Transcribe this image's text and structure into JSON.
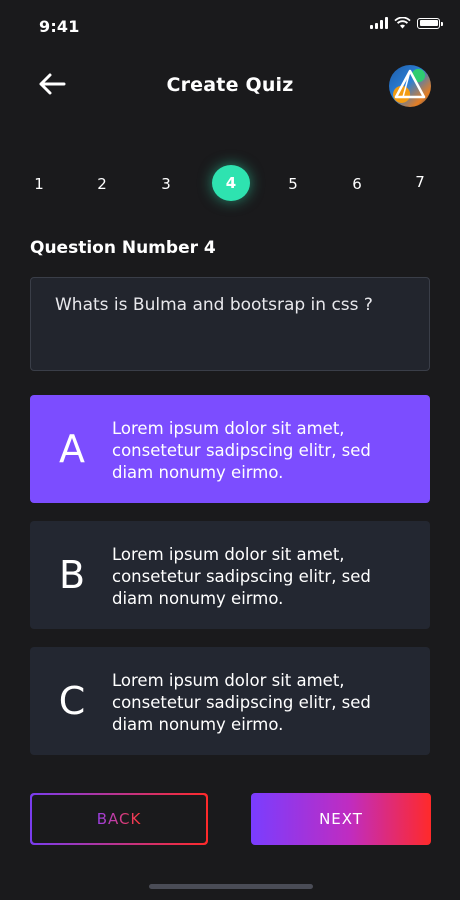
{
  "status_bar": {
    "time": "9:41"
  },
  "header": {
    "title": "Create Quiz"
  },
  "stepper": {
    "steps": [
      "1",
      "2",
      "3",
      "4",
      "5",
      "6",
      "7"
    ],
    "active_index": 3,
    "active_color": "#2ee3b0"
  },
  "question": {
    "label": "Question Number 4",
    "text": "Whats is Bulma and bootsrap in css ?"
  },
  "options": [
    {
      "letter": "A",
      "text": "Lorem ipsum dolor sit amet, consetetur sadipscing elitr, sed diam nonumy eirmo.",
      "selected": true
    },
    {
      "letter": "B",
      "text": "Lorem ipsum dolor sit amet, consetetur sadipscing elitr, sed diam nonumy eirmo.",
      "selected": false
    },
    {
      "letter": "C",
      "text": "Lorem ipsum dolor sit amet, consetetur sadipscing elitr, sed diam nonumy eirmo.",
      "selected": false
    }
  ],
  "buttons": {
    "back_label": "BACK",
    "next_label": "NEXT"
  },
  "colors": {
    "background": "#1a1a1c",
    "selected_option": "#7c4dff",
    "option_bg": "#232731",
    "gradient_start": "#7a3dff",
    "gradient_end": "#ff2a2a"
  },
  "icons": {
    "back": "arrow-left-icon",
    "avatar": "user-avatar",
    "signal": "cellular-signal-icon",
    "wifi": "wifi-icon",
    "battery": "battery-icon"
  }
}
